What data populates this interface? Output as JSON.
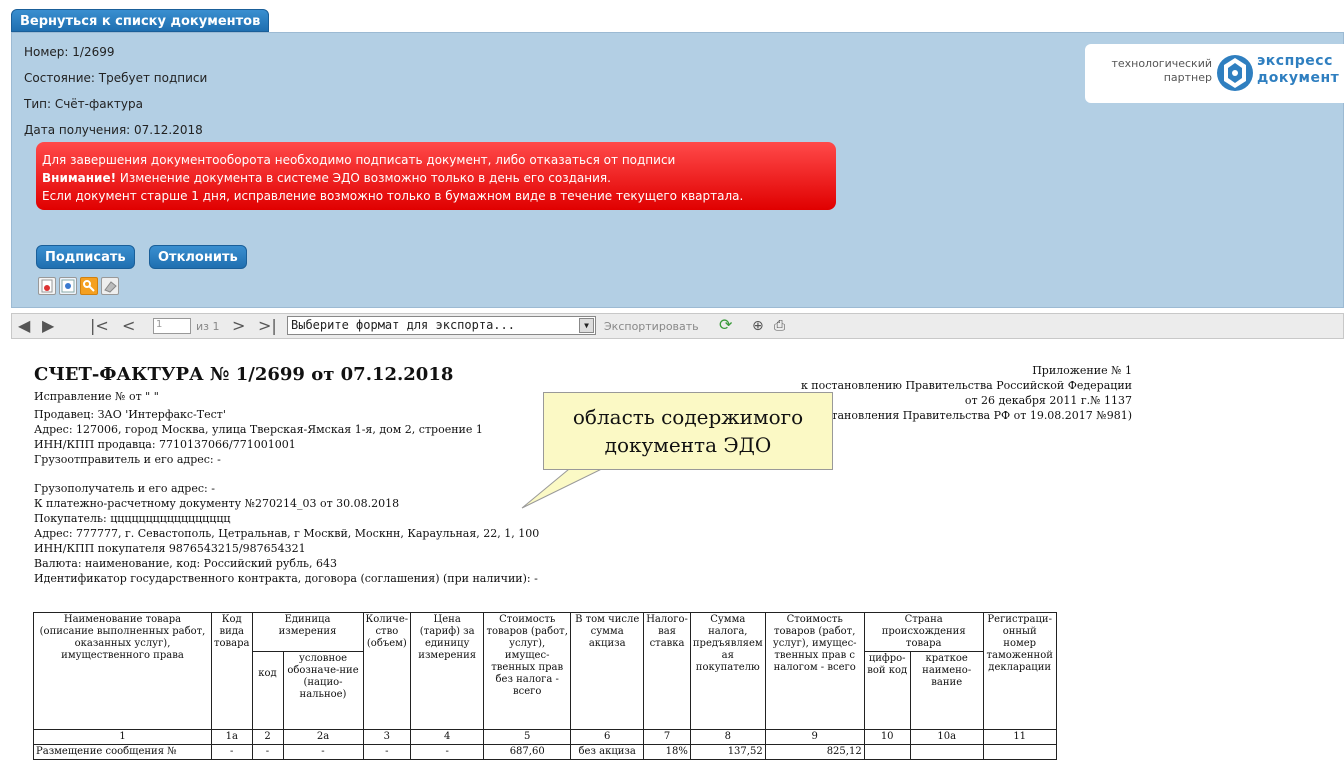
{
  "nav": {
    "back_label": "Вернуться к списку документов"
  },
  "info": {
    "number": "Номер: 1/2699",
    "state": "Состояние: Требует подписи",
    "type": "Тип: Счёт-фактура",
    "date": "Дата получения: 07.12.2018"
  },
  "logo": {
    "partner_line1": "технологический",
    "partner_line2": "партнер",
    "brand_line1": "экспресс",
    "brand_line2": "документ"
  },
  "alert": {
    "line1": "Для завершения документооборота необходимо подписать документ, либо отказаться от подписи",
    "line2_bold": "Внимание!",
    "line2_rest": " Изменение документа в системе ЭДО возможно только в день его создания.",
    "line3": "Если документ старше 1 дня, исправление возможно только в бумажном виде в течение текущего квартала."
  },
  "actions": {
    "sign_label": "Подписать",
    "reject_label": "Отклонить"
  },
  "toolbar": {
    "page_value": "1",
    "page_of": "из 1",
    "export_placeholder": "Выберите формат для экспорта...",
    "export_label": "Экспортировать"
  },
  "document": {
    "title": "СЧЕТ-ФАКТУРА № 1/2699 от 07.12.2018",
    "correction": "Исправление №  от \" \"",
    "seller": "Продавец: ЗАО 'Интерфакс-Тест'",
    "seller_address": "Адрес: 127006, город Москва, улица Тверская-Ямская 1-я, дом 2, строение 1",
    "seller_inn": "ИНН/КПП продавца: 7710137066/771001001",
    "shipper": "Грузоотправитель и его адрес: -",
    "consignee": "Грузополучатель и его адрес: -",
    "payment_doc": "К платежно-расчетному документу №270214_03 от 30.08.2018",
    "buyer": "Покупатель: ццццццццццццццццц",
    "buyer_address": "Адрес: 777777, г. Севастополь, Цетральнав, г Москвй, Москнн, Караульная, 22, 1, 100",
    "buyer_inn": "ИНН/КПП покупателя 9876543215/987654321",
    "currency": "Валюта: наименование, код: Российский рубль, 643",
    "contract_id": "Идентификатор государственного контракта, договора (соглашения) (при наличии): -",
    "appendix1": "Приложение № 1",
    "appendix2": "к постановлению Правительства Российской Федерации",
    "appendix3": "от 26 декабря 2011 г.№ 1137",
    "appendix4": "(в редакции постановления Правительства РФ от 19.08.2017 №981)"
  },
  "callout": {
    "line1": "область содержимого",
    "line2": "документа ЭДО"
  },
  "table": {
    "h_name": "Наименование товара (описание выполненных работ, оказанных услуг), имущественного права",
    "h_kind": "Код вида товара",
    "h_unit": "Единица измерения",
    "h_unit_code": "код",
    "h_unit_sym": "условное обозначе-ние (нацио-нальное)",
    "h_qty": "Количе-ство (объем)",
    "h_price": "Цена (тариф) за единицу измерения",
    "h_cost": "Стоимость товаров (работ, услуг), имущес-твенных прав без налога - всего",
    "h_excise": "В том числе сумма акциза",
    "h_rate": "Налого-вая ставка",
    "h_tax": "Сумма налога, предъявляем ая покупателю",
    "h_total": "Стоимость товаров (работ, услуг), имущес-твенных прав с налогом - всего",
    "h_country": "Страна происхождения товара",
    "h_country_code": "цифро-вой код",
    "h_country_name": "краткое наимено-вание",
    "h_decl": "Регистраци-онный номер таможенной декларации",
    "nums": [
      "1",
      "1а",
      "2",
      "2а",
      "3",
      "4",
      "5",
      "6",
      "7",
      "8",
      "9",
      "10",
      "10а",
      "11"
    ],
    "row1": [
      "Размещение сообщения №",
      "-",
      "-",
      "-",
      "-",
      "-",
      "687,60",
      "без акциза",
      "18%",
      "137,52",
      "825,12",
      "",
      "",
      ""
    ]
  }
}
